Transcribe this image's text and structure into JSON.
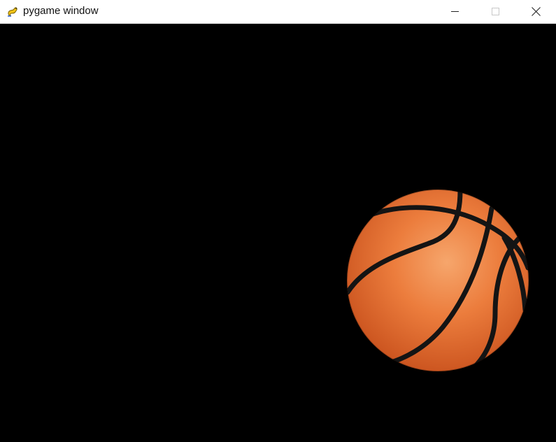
{
  "window": {
    "title": "pygame window",
    "app_icon": "pygame-snake-icon",
    "controls": {
      "minimize_icon": "minimize-icon",
      "maximize_icon": "maximize-icon",
      "close_icon": "close-icon"
    }
  },
  "canvas": {
    "background_color": "#000000",
    "sprite": {
      "name": "basketball",
      "base_color": "#e36a2c",
      "highlight_color": "#f4a066",
      "seam_color": "#141414"
    }
  }
}
